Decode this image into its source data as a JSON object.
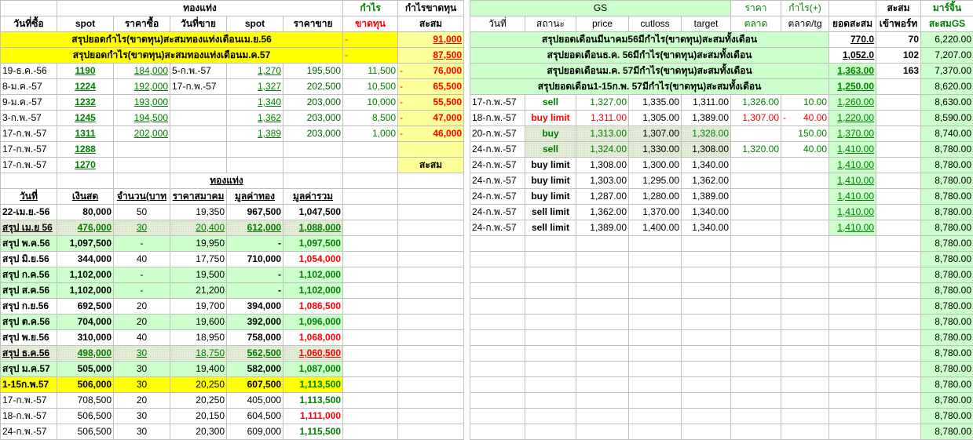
{
  "left": {
    "header1": {
      "gold_bar": "ทองแท่ง",
      "profit": "กำไร",
      "profit_loss": "กำไรขาดทุน"
    },
    "header2": [
      "วันที่ซื้อ",
      "spot",
      "ราคาซื้อ",
      "วันที่ขาย",
      "spot",
      "ราคาขาย",
      "ขาดทุน",
      "สะสม"
    ],
    "summaries": [
      {
        "label": "สรุปยอดกำไร(ขาดทุน)สะสมทองแท่งเดือนเม.ย.56",
        "sign": "-",
        "value": "91,000"
      },
      {
        "label": "สรุปยอดกำไร(ขาดทุน)สะสมทองแท่งเดือนม.ค.57",
        "sign": "-",
        "value": "87,500"
      }
    ],
    "trades": [
      {
        "buy_date": "19-ธ.ค.-56",
        "spot": "1190",
        "buy_price": "184,000",
        "sell_date": "5-ก.พ.-57",
        "sell_spot": "1,270",
        "sell_price": "195,500",
        "profit": "11,500",
        "sign": "-",
        "cum": "76,000"
      },
      {
        "buy_date": "8-ม.ค.-57",
        "spot": "1224",
        "buy_price": "192,000",
        "sell_date": "17-ก.พ.-57",
        "sell_spot": "1,327",
        "sell_price": "202,500",
        "profit": "10,500",
        "sign": "-",
        "cum": "65,500"
      },
      {
        "buy_date": "9-ม.ค.-57",
        "spot": "1232",
        "buy_price": "193,000",
        "sell_date": "",
        "sell_spot": "1,340",
        "sell_price": "203,000",
        "profit": "10,000",
        "sign": "-",
        "cum": "55,500"
      },
      {
        "buy_date": "3-ก.พ.-57",
        "spot": "1245",
        "buy_price": "194,500",
        "sell_date": "",
        "sell_spot": "1,362",
        "sell_price": "203,000",
        "profit": "8,500",
        "sign": "-",
        "cum": "47,000"
      },
      {
        "buy_date": "17-ก.พ.-57",
        "spot": "1311",
        "buy_price": "202,000",
        "sell_date": "",
        "sell_spot": "1,389",
        "sell_price": "203,000",
        "profit": "1,000",
        "sign": "-",
        "cum": "46,000"
      },
      {
        "buy_date": "17-ก.พ.-57",
        "spot": "1288",
        "buy_price": "",
        "sell_date": "",
        "sell_spot": "",
        "sell_price": "",
        "profit": "",
        "sign": "",
        "cum": ""
      },
      {
        "buy_date": "17-ก.พ.-57",
        "spot": "1270",
        "buy_price": "",
        "sell_date": "",
        "sell_spot": "",
        "sell_price": "",
        "profit": "",
        "sign": "",
        "cum": "สะสม"
      }
    ],
    "section_title": "ทองแท่ง",
    "sub_header": [
      "วันที่",
      "เงินสด",
      "จำนวน(บาท",
      "ราคาสมาคม",
      "มูลค่าทอง",
      "มูลค่ารวม"
    ],
    "holdings": [
      {
        "date": "22-เม.ย.-56",
        "cash": "80,000",
        "qty": "50",
        "price": "19,350",
        "gold_value": "967,500",
        "total": "1,047,500",
        "style": "plain",
        "total_color": "black"
      },
      {
        "date": "สรุป เม.ย 56",
        "cash": "476,000",
        "qty": "30",
        "price": "20,400",
        "gold_value": "612,000",
        "total": "1,088,000",
        "style": "hatch",
        "total_color": "green"
      },
      {
        "date": "สรุป พ.ค.56",
        "cash": "1,097,500",
        "qty": "-",
        "price": "19,950",
        "gold_value": "-",
        "total": "1,097,500",
        "style": "green",
        "total_color": "green"
      },
      {
        "date": "สรุป มิ.ย.56",
        "cash": "344,000",
        "qty": "40",
        "price": "17,750",
        "gold_value": "710,000",
        "total": "1,054,000",
        "style": "plain",
        "total_color": "red"
      },
      {
        "date": "สรุป ก.ค.56",
        "cash": "1,102,000",
        "qty": "-",
        "price": "19,500",
        "gold_value": "-",
        "total": "1,102,000",
        "style": "green",
        "total_color": "green"
      },
      {
        "date": "สรุป ส.ค.56",
        "cash": "1,102,000",
        "qty": "-",
        "price": "21,200",
        "gold_value": "-",
        "total": "1,102,000",
        "style": "green",
        "total_color": "green"
      },
      {
        "date": "สรุป ก.ย.56",
        "cash": "692,500",
        "qty": "20",
        "price": "19,700",
        "gold_value": "394,000",
        "total": "1,086,500",
        "style": "plain",
        "total_color": "red"
      },
      {
        "date": "สรุป ต.ค.56",
        "cash": "704,000",
        "qty": "20",
        "price": "19,600",
        "gold_value": "392,000",
        "total": "1,096,000",
        "style": "green",
        "total_color": "green"
      },
      {
        "date": "สรุป พ.ย.56",
        "cash": "310,000",
        "qty": "40",
        "price": "18,950",
        "gold_value": "758,000",
        "total": "1,068,000",
        "style": "plain",
        "total_color": "red"
      },
      {
        "date": "สรุป ธ.ค.56",
        "cash": "498,000",
        "qty": "30",
        "price": "18,750",
        "gold_value": "562,500",
        "total": "1,060,500",
        "style": "hatch",
        "total_color": "red"
      },
      {
        "date": "สรุป ม.ค.57",
        "cash": "505,000",
        "qty": "30",
        "price": "19,400",
        "gold_value": "582,000",
        "total": "1,087,000",
        "style": "green",
        "total_color": "green"
      },
      {
        "date": "1-15ก.พ.57",
        "cash": "506,000",
        "qty": "30",
        "price": "20,250",
        "gold_value": "607,500",
        "total": "1,113,500",
        "style": "yellow",
        "total_color": "green"
      },
      {
        "date": "17-ก.พ.-57",
        "cash": "708,500",
        "qty": "20",
        "price": "20,250",
        "gold_value": "405,000",
        "total": "1,113,500",
        "style": "normal",
        "total_color": "green"
      },
      {
        "date": "18-ก.พ.-57",
        "cash": "506,500",
        "qty": "30",
        "price": "20,150",
        "gold_value": "604,500",
        "total": "1,111,000",
        "style": "normal",
        "total_color": "red"
      },
      {
        "date": "24-ก.พ.-57",
        "cash": "506,500",
        "qty": "30",
        "price": "20,300",
        "gold_value": "609,000",
        "total": "1,115,500",
        "style": "normal",
        "total_color": "green"
      }
    ]
  },
  "right": {
    "header1": {
      "gs": "GS",
      "price": "ราคา",
      "profit": "กำไร(+)",
      "cum": "สะสม",
      "margin": "มาร์จิ้น"
    },
    "header2": [
      "วันที่",
      "สถานะ",
      "price",
      "cutloss",
      "target",
      "ตลาด",
      "ตลาด/tg",
      "ยอดสะสม",
      "เข้าพอร์ท",
      "สะสมGS"
    ],
    "summaries": [
      {
        "label": "สรุปยอดเดือนมีนาคม56มีกำไร(ขาดทุน)สะสมทั้งเดือน",
        "total": "770.0",
        "port": "70",
        "gs": "6,220.00",
        "style": "plain"
      },
      {
        "label": "สรุปยอดเดือนธ.ค. 56มีกำไร(ขาดทุน)สะสมทั้งเดือน",
        "total": "1,052.0",
        "port": "102",
        "gs": "7,207.00",
        "style": "plain"
      },
      {
        "label": "สรุปยอดเดือนม.ค. 57มีกำไร(ขาดทุน)สะสมทั้งเดือน",
        "total": "1,363.00",
        "port": "163",
        "gs": "7,370.00",
        "style": "green"
      },
      {
        "label": "สรุปยอดเดือน1-15ก.พ. 57มีกำไร(ขาดทุน)สะสมทั้งเดือน",
        "total": "1,250.00",
        "port": "",
        "gs": "8,620.00",
        "style": "green"
      }
    ],
    "orders": [
      {
        "date": "17-ก.พ.-57",
        "status": "sell",
        "price": "1,327.00",
        "cutloss": "1,335.00",
        "target": "1,311.00",
        "market": "1,326.00",
        "sign": "",
        "pl": "10.00",
        "total": "1,260.00",
        "gs": "8,630.00",
        "status_color": "green",
        "price_color": "green"
      },
      {
        "date": "18-ก.พ.-57",
        "status": "buy limit",
        "price": "1,311.00",
        "cutloss": "1,305.00",
        "target": "1,389.00",
        "market": "1,307.00",
        "sign": "-",
        "pl": "40.00",
        "total": "1,220.00",
        "gs": "8,590.00",
        "status_color": "red",
        "price_color": "red"
      },
      {
        "date": "20-ก.พ.-57",
        "status": "buy",
        "price": "1,313.00",
        "cutloss": "1,307.00",
        "target": "1,328.00",
        "market": "",
        "sign": "",
        "pl": "150.00",
        "total": "1,370.00",
        "gs": "8,740.00",
        "status_color": "green",
        "price_color": "green"
      },
      {
        "date": "24-ก.พ.-57",
        "status": "sell",
        "price": "1,324.00",
        "cutloss": "1,330.00",
        "target": "1,308.00",
        "market": "1,320.00",
        "sign": "",
        "pl": "40.00",
        "total": "1,410.00",
        "gs": "8,780.00",
        "status_color": "green",
        "price_color": "green"
      },
      {
        "date": "24-ก.พ.-57",
        "status": "buy limit",
        "price": "1,308.00",
        "cutloss": "1,300.00",
        "target": "1,340.00",
        "market": "",
        "sign": "",
        "pl": "",
        "total": "1,410.00",
        "gs": "8,780.00",
        "status_color": "black",
        "price_color": "black"
      },
      {
        "date": "24-ก.พ.-57",
        "status": "buy limit",
        "price": "1,303.00",
        "cutloss": "1,295.00",
        "target": "1,362.00",
        "market": "",
        "sign": "",
        "pl": "",
        "total": "1,410.00",
        "gs": "8,780.00",
        "status_color": "black",
        "price_color": "black"
      },
      {
        "date": "24-ก.พ.-57",
        "status": "buy limit",
        "price": "1,287.00",
        "cutloss": "1,280.00",
        "target": "1,389.00",
        "market": "",
        "sign": "",
        "pl": "",
        "total": "1,410.00",
        "gs": "8,780.00",
        "status_color": "black",
        "price_color": "black"
      },
      {
        "date": "24-ก.พ.-57",
        "status": "sell limit",
        "price": "1,362.00",
        "cutloss": "1,370.00",
        "target": "1,340.00",
        "market": "",
        "sign": "",
        "pl": "",
        "total": "1,410.00",
        "gs": "8,780.00",
        "status_color": "black",
        "price_color": "black"
      },
      {
        "date": "24-ก.พ.-57",
        "status": "sell limit",
        "price": "1,389.00",
        "cutloss": "1,400.00",
        "target": "1,340.00",
        "market": "",
        "sign": "",
        "pl": "",
        "total": "1,410.00",
        "gs": "8,780.00",
        "status_color": "black",
        "price_color": "black"
      }
    ],
    "filler_gs": [
      "8,780.00",
      "8,780.00",
      "8,780.00",
      "8,780.00",
      "8,780.00",
      "8,780.00",
      "8,780.00",
      "8,780.00",
      "8,780.00",
      "8,780.00",
      "8,780.00",
      "8,780.00",
      "8,780.00"
    ]
  },
  "colors": {
    "green_text": "#008000",
    "red_text": "#ff0000",
    "green_fill": "#ccffcc",
    "yellow_fill": "#ffff99",
    "bright_yellow": "#ffff00"
  }
}
